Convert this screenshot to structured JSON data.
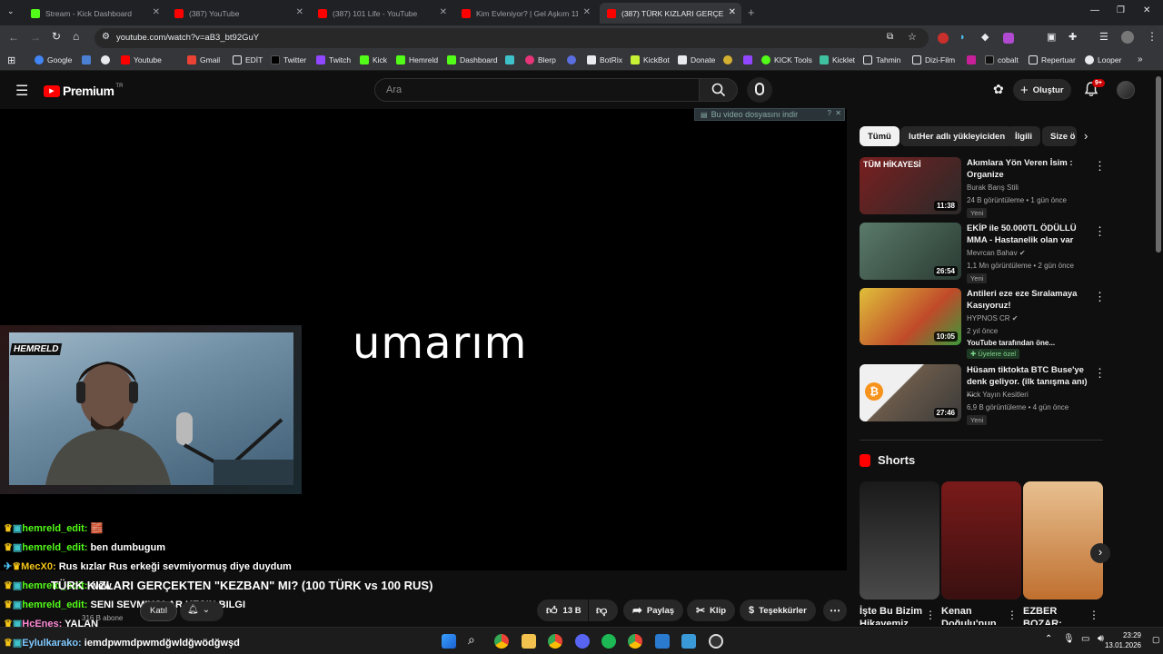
{
  "browser": {
    "tabs": [
      {
        "title": "Stream - Kick Dashboard",
        "favicon_color": "#53fc18"
      },
      {
        "title": "(387) YouTube",
        "favicon_color": "#ff0000"
      },
      {
        "title": "(387) 101 Life - YouTube",
        "favicon_color": "#ff0000"
      },
      {
        "title": "Kim Evleniyor? | Gel Aşkım 11.",
        "favicon_color": "#ff0000"
      },
      {
        "title": "(387) TÜRK KIZLARI GERÇEKTEN",
        "favicon_color": "#ff0000"
      }
    ],
    "url": "youtube.com/watch?v=aB3_bt92GuY",
    "bookmarks": [
      "Google",
      "Youtube",
      "Gmail",
      "EDİT",
      "Twitter",
      "Twitch",
      "Kick",
      "Hemreld",
      "Dashboard",
      "Blerp",
      "BotRix",
      "KickBot",
      "Donate",
      "KICK Tools",
      "Kicklet",
      "Tahmin",
      "Dizi-Film",
      "cobalt",
      "Repertuar",
      "Looper"
    ]
  },
  "youtube": {
    "logo_text": "Premium",
    "logo_superscript": "TR",
    "search_placeholder": "Ara",
    "create_label": "Oluştur",
    "notification_count": "9+"
  },
  "video": {
    "caption_text": "umarım",
    "download_banner": "Bu video dosyasını indir",
    "title": "TÜRK KIZLARI GERÇEKTEN \"KEZBAN\" MI? (100 TÜRK vs 100 RUS)",
    "join_label": "Katıl",
    "subscriber_count": "316 B abone",
    "like_count": "13 B",
    "share_label": "Paylaş",
    "clip_label": "Klip",
    "thanks_label": "Teşekkürler"
  },
  "webcam": {
    "brand_text": "HEMRELD"
  },
  "chat": [
    {
      "user": "hemreld_edit:",
      "message": "🧱"
    },
    {
      "user": "hemreld_edit:",
      "message": "ben dumbugum"
    },
    {
      "user": "MecX0:",
      "message": "Rus kızlar Rus erkeği sevmiyormuş diye duydum"
    },
    {
      "user": "hemreld_edit:",
      "message": "wew"
    },
    {
      "user": "hemreld_edit:",
      "message": "SENI SEVMIYOLAR KESIN BILGI"
    },
    {
      "user": "HcEnes:",
      "message": "YALAN"
    },
    {
      "user": "Eylulkarako:",
      "message": "iemdpwmdpwmdğwldğwödğwşd"
    }
  ],
  "sidebar": {
    "chips": [
      "Tümü",
      "lutHer adlı yükleyiciden",
      "İlgili",
      "Size ö"
    ],
    "videos": [
      {
        "title": "Akımlara Yön Veren İsim : Organize",
        "channel": "Burak Barış Stili",
        "meta": "24 B görüntüleme • 1 gün önce",
        "badge": "Yeni",
        "duration": "11:38",
        "thumb_color": "#8c2a2a"
      },
      {
        "title": "EKİP ile 50.000TL ÖDÜLLÜ MMA - Hastanelik olan var",
        "channel": "Mevrcan Bahav",
        "meta": "1,1 Mn görüntüleme • 2 gün önce",
        "badge": "Yeni",
        "duration": "26:54",
        "thumb_color": "#4a6a5a"
      },
      {
        "title": "Antileri eze eze Sıralamaya Kasıyoruz!",
        "channel": "HYPNOS CR",
        "meta": "2 yıl önce",
        "meta2": "YouTube tarafından öne...",
        "badge": "Üyelere özel",
        "duration": "10:05",
        "thumb_color": "#d4a82a"
      },
      {
        "title": "Hüsam tiktokta BTC Buse'ye denk geliyor. (ilk tanışma anı) ...",
        "channel": "Kick Yayın Kesitleri",
        "meta": "6,9 B görüntüleme • 4 gün önce",
        "badge": "Yeni",
        "duration": "27:46",
        "thumb_color": "#6a5a4a"
      }
    ],
    "shorts_title": "Shorts",
    "shorts": [
      {
        "title": "İşte Bu Bizim Hikayemiz",
        "color": "#3a3a3a"
      },
      {
        "title": "Kenan Doğulu'nun",
        "color": "#5a2020"
      },
      {
        "title": "EZBER BOZAR:",
        "color": "#d08a4a"
      }
    ]
  },
  "taskbar": {
    "time": "23:29",
    "date": "13.01.2026"
  }
}
